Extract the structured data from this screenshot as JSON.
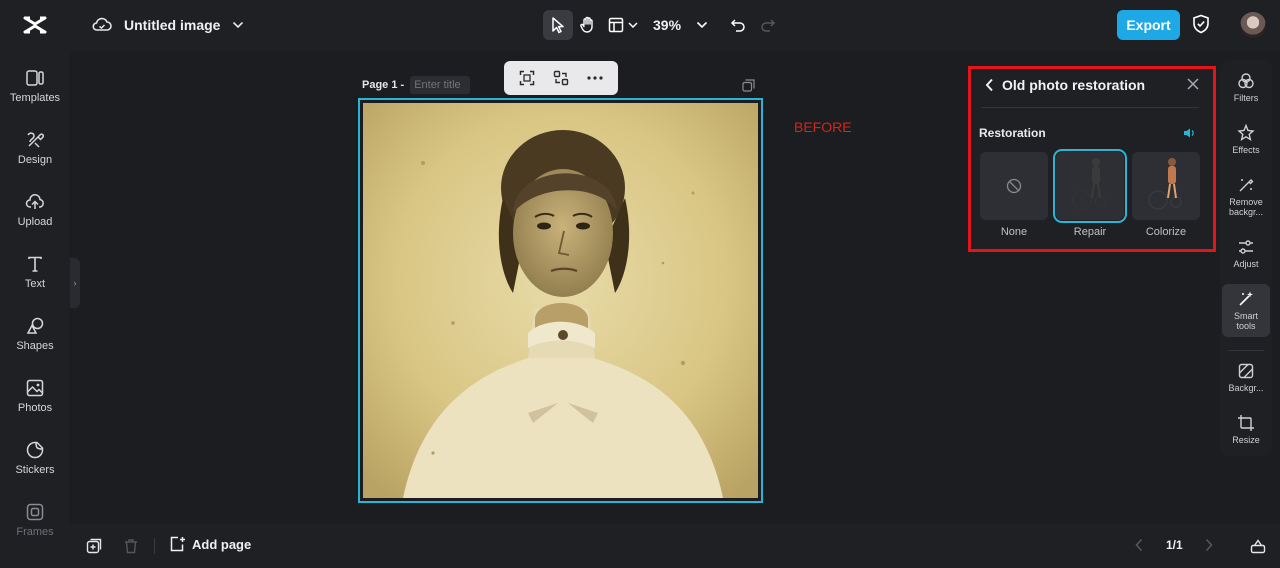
{
  "header": {
    "title": "Untitled image",
    "zoom": "39%",
    "export_label": "Export"
  },
  "sidebar": {
    "items": [
      {
        "label": "Templates",
        "icon": "templates-icon"
      },
      {
        "label": "Design",
        "icon": "design-icon"
      },
      {
        "label": "Upload",
        "icon": "upload-icon"
      },
      {
        "label": "Text",
        "icon": "text-icon"
      },
      {
        "label": "Shapes",
        "icon": "shapes-icon"
      },
      {
        "label": "Photos",
        "icon": "photos-icon"
      },
      {
        "label": "Stickers",
        "icon": "stickers-icon"
      },
      {
        "label": "Frames",
        "icon": "frames-icon"
      }
    ]
  },
  "canvas": {
    "page_label": "Page 1 -",
    "page_title_placeholder": "Enter title",
    "annotation": "BEFORE"
  },
  "panel": {
    "title": "Old photo restoration",
    "section": "Restoration",
    "options": [
      {
        "label": "None"
      },
      {
        "label": "Repair"
      },
      {
        "label": "Colorize"
      }
    ],
    "selected": "Repair"
  },
  "rightrail": {
    "items": [
      {
        "label": "Filters",
        "icon": "filters-icon"
      },
      {
        "label": "Effects",
        "icon": "effects-icon"
      },
      {
        "label": "Remove backgr...",
        "icon": "remove-background-icon"
      },
      {
        "label": "Adjust",
        "icon": "adjust-icon"
      },
      {
        "label": "Smart tools",
        "icon": "smart-tools-icon"
      },
      {
        "label": "Backgr...",
        "icon": "background-icon"
      },
      {
        "label": "Resize",
        "icon": "resize-icon"
      }
    ],
    "active": "Smart tools"
  },
  "footer": {
    "add_page_label": "Add page",
    "pager": "1/1"
  },
  "colors": {
    "accent": "#29b6d6",
    "export": "#1fa8e6",
    "highlight_border": "#e3141a",
    "annotation": "#d0261c"
  }
}
